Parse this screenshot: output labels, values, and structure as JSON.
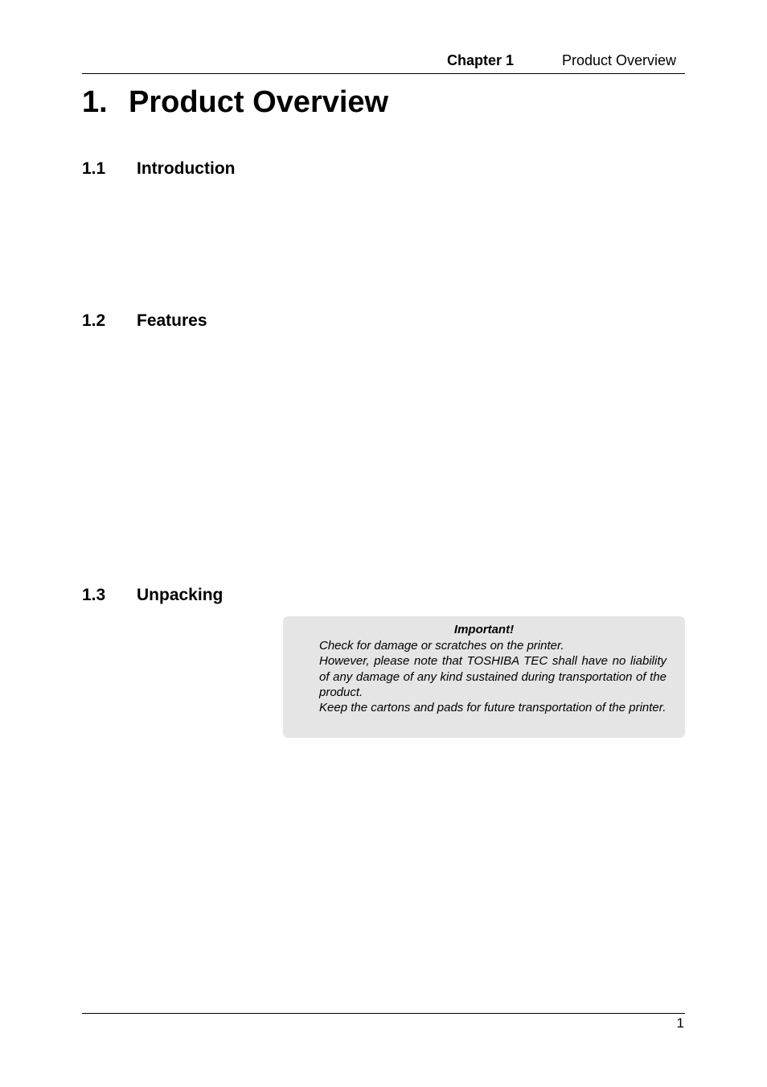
{
  "header": {
    "chapter": "Chapter 1",
    "title": "Product Overview"
  },
  "heading": {
    "number": "1.",
    "title": "Product Overview"
  },
  "sections": [
    {
      "number": "1.1",
      "title": "Introduction"
    },
    {
      "number": "1.2",
      "title": "Features"
    },
    {
      "number": "1.3",
      "title": "Unpacking"
    }
  ],
  "important_note": {
    "title": "Important!",
    "paragraphs": [
      "Check for damage or scratches on the printer.",
      "However, please note that TOSHIBA TEC shall have no liability of any damage of any kind sustained during transportation of the product.",
      "Keep the cartons and pads for future transportation of the printer."
    ]
  },
  "footer": {
    "page_number": "1"
  }
}
